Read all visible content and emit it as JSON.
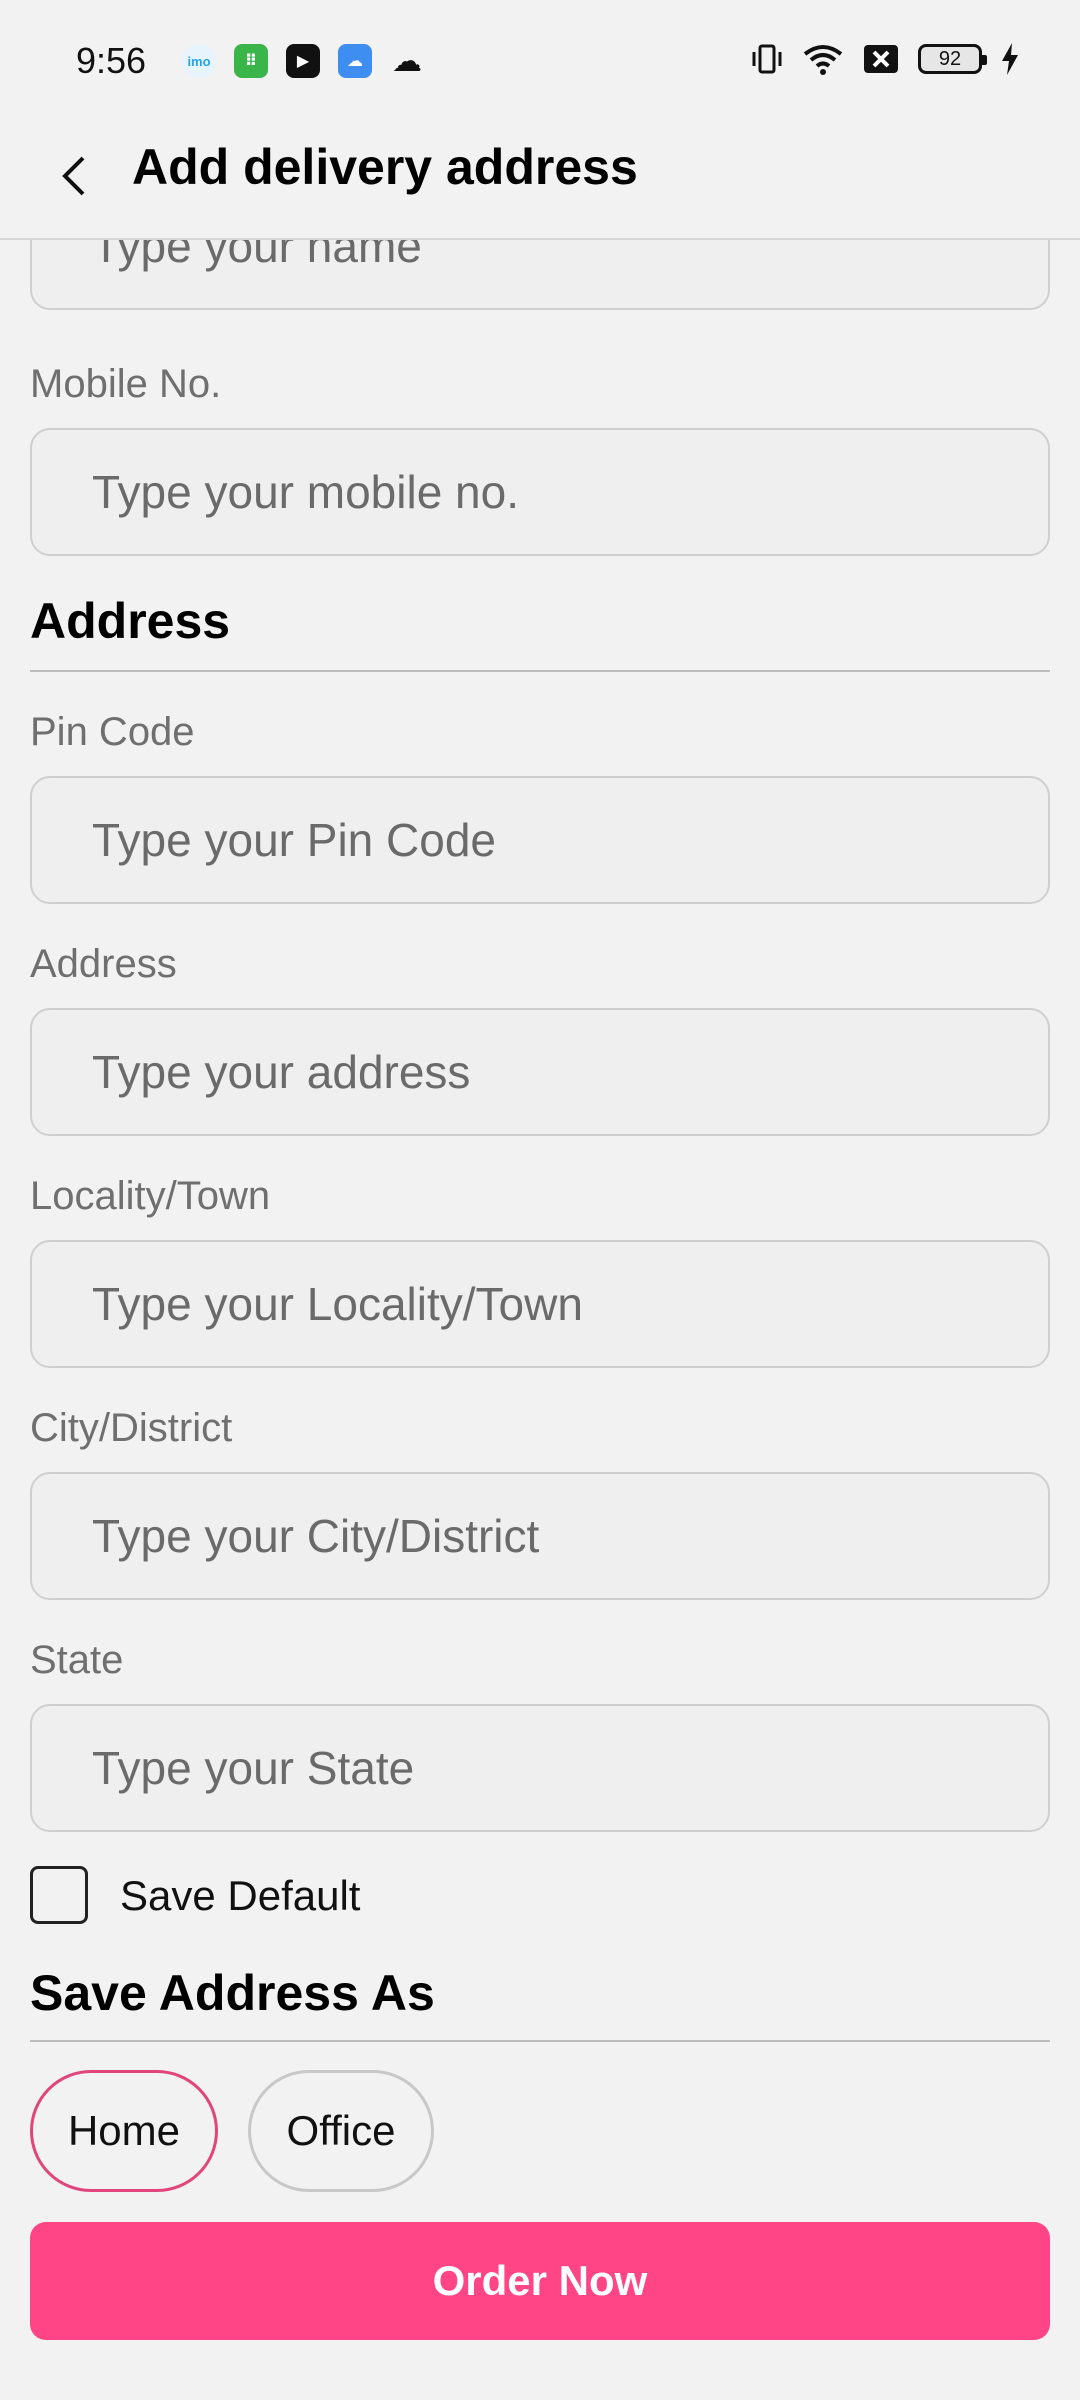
{
  "status_bar": {
    "time": "9:56",
    "apps": [
      {
        "name": "imo-icon",
        "label": "imo",
        "color": "#2aa3e6"
      },
      {
        "name": "shop-app-icon",
        "label": "::",
        "color": "#3ab54a"
      },
      {
        "name": "youtube-icon",
        "label": "▶",
        "color": "#111111"
      },
      {
        "name": "weather-icon",
        "label": "☁",
        "color": "#3d8ef0"
      },
      {
        "name": "cloud-icon",
        "label": "☁",
        "color": "#111111"
      }
    ],
    "battery_level": "92"
  },
  "app_bar": {
    "title": "Add delivery address"
  },
  "form": {
    "name": {
      "placeholder": "Type your name"
    },
    "mobile": {
      "label": "Mobile No.",
      "placeholder": "Type your mobile no."
    },
    "address_section_title": "Address",
    "pin": {
      "label": "Pin Code",
      "placeholder": "Type your Pin Code"
    },
    "address": {
      "label": "Address",
      "placeholder": "Type your address"
    },
    "locality": {
      "label": "Locality/Town",
      "placeholder": "Type your Locality/Town"
    },
    "city": {
      "label": "City/District",
      "placeholder": "Type your City/District"
    },
    "state": {
      "label": "State",
      "placeholder": "Type your State"
    },
    "save_default_label": "Save Default",
    "save_as_title": "Save Address As",
    "chips": {
      "home": "Home",
      "office": "Office"
    },
    "selected_chip": "Home",
    "submit_label": "Order Now"
  },
  "colors": {
    "accent": "#ff4585",
    "chip_selected_border": "#e0457b",
    "background": "#f2f2f2"
  }
}
